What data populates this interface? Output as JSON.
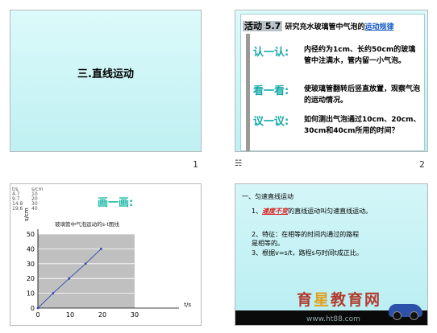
{
  "slide1": {
    "title": "三.直线运动",
    "number": "1"
  },
  "slide2": {
    "number": "2",
    "note_icon": "note-icon",
    "header_activity": "活动 5.7",
    "header_text": "研究充水玻璃管中气泡的",
    "header_link": "运动规律",
    "items": [
      {
        "label": "认一认:",
        "text": "内径约为1cm、长约50cm的玻璃管中注满水，管内留一小气泡。"
      },
      {
        "label": "看一看:",
        "text": "使玻璃管翻转后竖直放置，观察气泡的运动情况。"
      },
      {
        "label": "议一议:",
        "text": "如何测出气泡通过10cm、20cm、30cm和40cm所用的时间？"
      }
    ]
  },
  "slide3": {
    "table_headers": [
      "t/s",
      "s/cm"
    ],
    "table_rows": [
      [
        "4.7",
        "10"
      ],
      [
        "9.7",
        "20"
      ],
      [
        "14.8",
        "30"
      ],
      [
        "19.6",
        "40"
      ]
    ],
    "heading": "画一画:"
  },
  "slide4": {
    "line1": "一、匀速直线运动",
    "line2_prefix": "1、",
    "line2_red": "速度不变",
    "line2_rest": "的直线运动叫匀速直线运动。",
    "line3": "2、特征：在相等的时间内通过的路程是相等的。",
    "line4": "3、根据v=s/t，路程s与时间t成正比。",
    "watermark_a": "育",
    "watermark_star": "星",
    "watermark_b": "教育网",
    "url": "www.ht88.com",
    "car_icon": "car-icon"
  },
  "chart_data": {
    "type": "line",
    "title": "玻璃管中气泡运动的s-t图线",
    "xlabel": "t/s",
    "ylabel": "s/cm",
    "xlim": [
      0,
      30
    ],
    "ylim": [
      0,
      50
    ],
    "xticks": [
      0,
      10,
      20,
      30
    ],
    "yticks": [
      0,
      10,
      20,
      30,
      40,
      50
    ],
    "grid": true,
    "series": [
      {
        "x": [
          0,
          4.7,
          9.7,
          14.8,
          19.6
        ],
        "y": [
          0,
          10,
          20,
          30,
          40
        ]
      }
    ],
    "colors": {
      "plot_bg": "#c0c0c0",
      "line": "#2f48a8"
    }
  }
}
